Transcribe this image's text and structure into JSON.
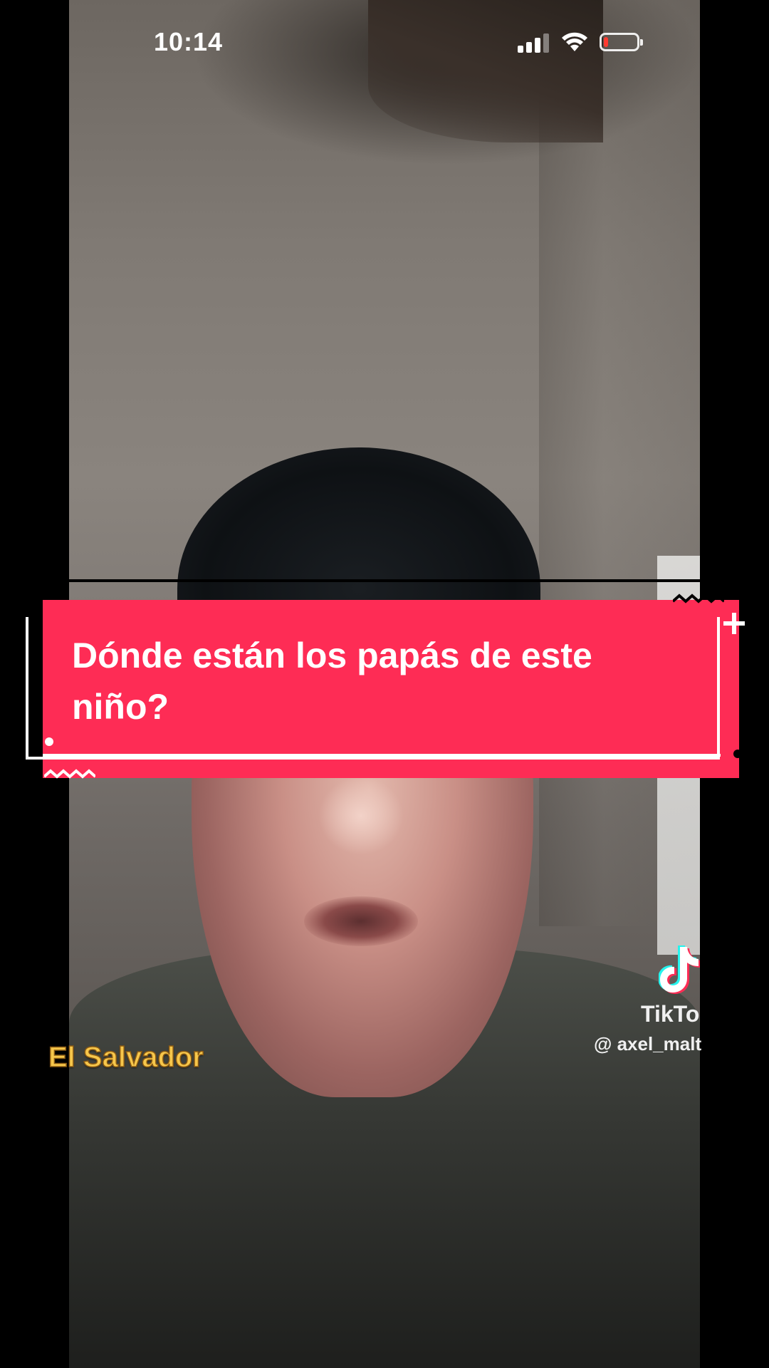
{
  "status_bar": {
    "time": "10:14",
    "battery_level": 0.1,
    "battery_color": "#ff3b30"
  },
  "caption": {
    "text": "Dónde están los papás de este niño?",
    "background_color": "#fe2c55"
  },
  "watermark": {
    "brand": "TikTo",
    "handle": "@ axel_malt"
  },
  "location_label": "El Salvador",
  "icons": {
    "signal": "cellular-signal-icon",
    "wifi": "wifi-icon",
    "battery": "battery-icon",
    "tiktok": "tiktok-logo-icon"
  }
}
